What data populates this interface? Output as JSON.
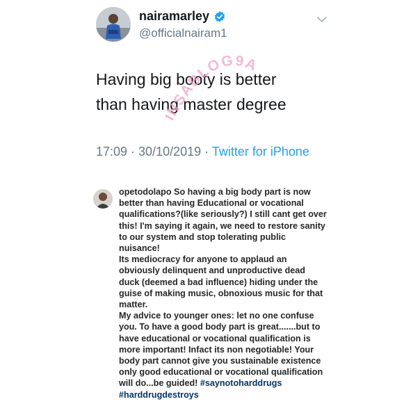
{
  "tweet": {
    "author_name": "nairamarley",
    "author_handle": "@officialnairam1",
    "text": "Having big booty is better\nthan having master degree",
    "timestamp": "17:09 · 30/10/2019 · ",
    "source": "Twitter for iPhone",
    "verified_color": "#1da1f2",
    "watermark_text": "INSABLOG9A"
  },
  "comment": {
    "username": "opetodolapo",
    "paragraph1": " So having a big body part is now better than having Educational or vocational qualifications?(like seriously?) I still cant get over this! I'm saying it again, we need to restore sanity to our system and stop tolerating public nuisance!",
    "paragraph2": "Its mediocracy for anyone  to applaud an obviously delinquent and unproductive dead duck (deemed a bad influence) hiding under the guise of making music, obnoxious music for that matter.",
    "paragraph3": "My advice to younger ones: let no one confuse you. To have a good body part is great.......but to have educational or vocational qualification is more important! Infact its non negotiable! Your body part cannot give you sustainable existence only good educational or vocational qualification will do...be guided! ",
    "hashtag1": "#saynotoharddrugs",
    "hashtag2": "#harddrugdestroys",
    "hashtag_color": "#003569"
  }
}
